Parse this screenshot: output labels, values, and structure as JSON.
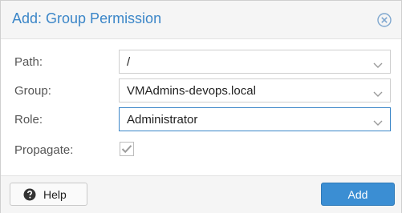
{
  "dialog": {
    "title": "Add: Group Permission",
    "close_icon": "close-circle-icon"
  },
  "form": {
    "path": {
      "label": "Path:",
      "value": "/"
    },
    "group": {
      "label": "Group:",
      "value": "VMAdmins-devops.local"
    },
    "role": {
      "label": "Role:",
      "value": "Administrator"
    },
    "propagate": {
      "label": "Propagate:",
      "checked": true
    }
  },
  "footer": {
    "help_label": "Help",
    "help_icon": "question-circle-icon",
    "add_label": "Add"
  },
  "colors": {
    "accent": "#3b86c8",
    "primary_button": "#3b8ed3"
  }
}
